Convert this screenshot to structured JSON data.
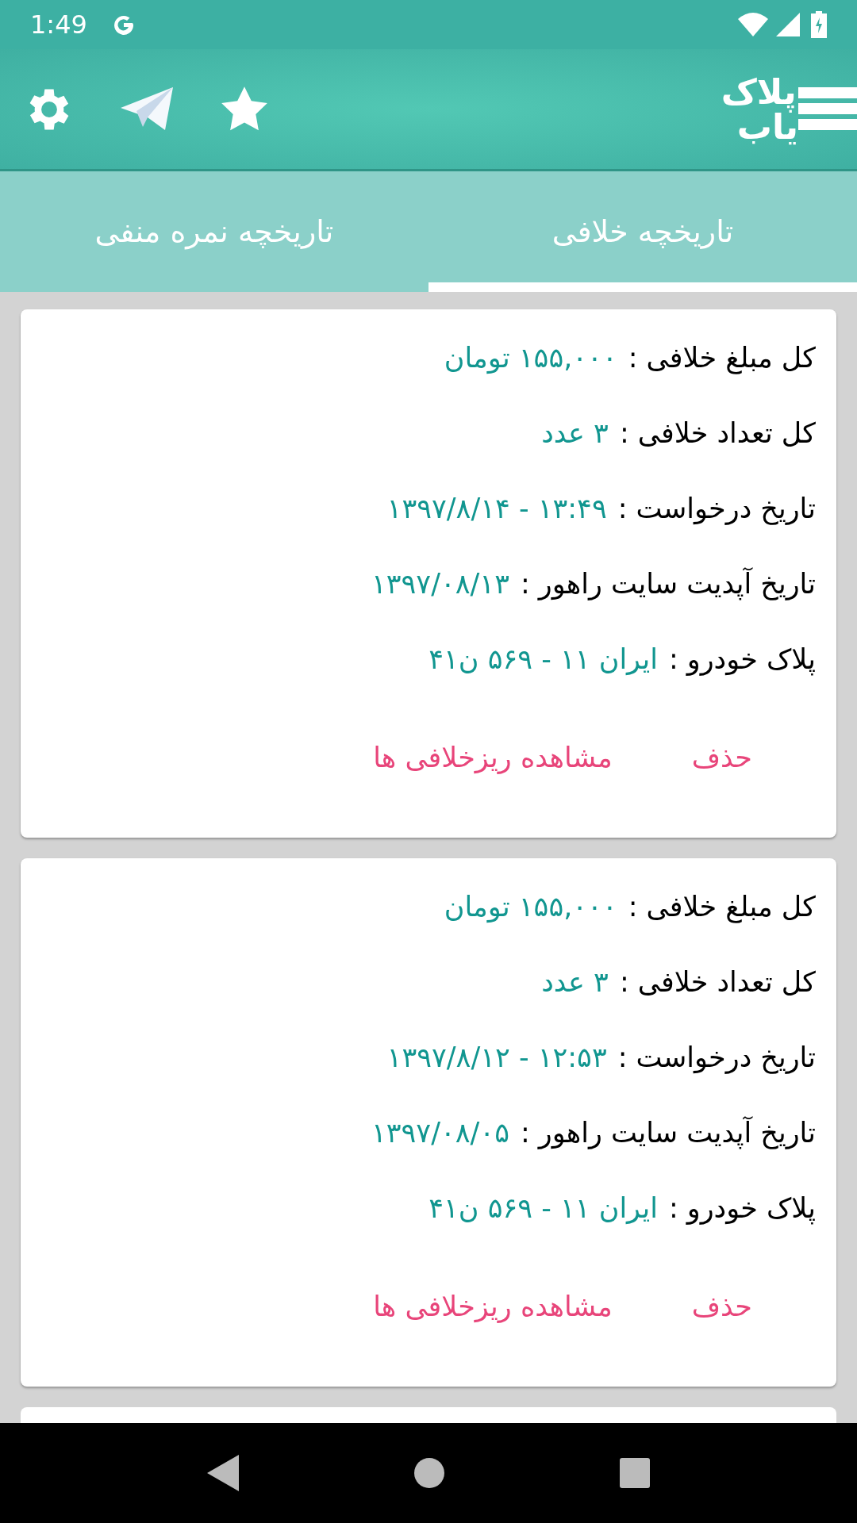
{
  "status_bar": {
    "time": "1:49"
  },
  "app_bar": {
    "logo": [
      "پلاک",
      "یاب"
    ]
  },
  "tabs": [
    {
      "label": "تاریخچه خلافی",
      "selected": true
    },
    {
      "label": "تاریخچه نمره منفی",
      "selected": false
    }
  ],
  "cards": [
    {
      "rows": [
        {
          "label": "کل مبلغ خلافی :",
          "value": "۱۵۵,۰۰۰ تومان"
        },
        {
          "label": "کل تعداد خلافی :",
          "value": "۳ عدد"
        },
        {
          "label": "تاریخ درخواست :",
          "value": "۱۳:۴۹ - ۱۳۹۷/۸/۱۴"
        },
        {
          "label": "تاریخ آپدیت سایت راهور :",
          "value": "۱۳۹۷/۰۸/۱۳"
        },
        {
          "label": "پلاک خودرو :",
          "value": "ایران ۱۱ - ۵۶۹ ن۴۱"
        }
      ],
      "actions": [
        "حذف",
        "مشاهده ریزخلافی ها"
      ]
    },
    {
      "rows": [
        {
          "label": "کل مبلغ خلافی :",
          "value": "۱۵۵,۰۰۰ تومان"
        },
        {
          "label": "کل تعداد خلافی :",
          "value": "۳ عدد"
        },
        {
          "label": "تاریخ درخواست :",
          "value": "۱۲:۵۳ - ۱۳۹۷/۸/۱۲"
        },
        {
          "label": "تاریخ آپدیت سایت راهور :",
          "value": "۱۳۹۷/۰۸/۰۵"
        },
        {
          "label": "پلاک خودرو :",
          "value": "ایران ۱۱ - ۵۶۹ ن۴۱"
        }
      ],
      "actions": [
        "حذف",
        "مشاهده ریزخلافی ها"
      ]
    }
  ]
}
